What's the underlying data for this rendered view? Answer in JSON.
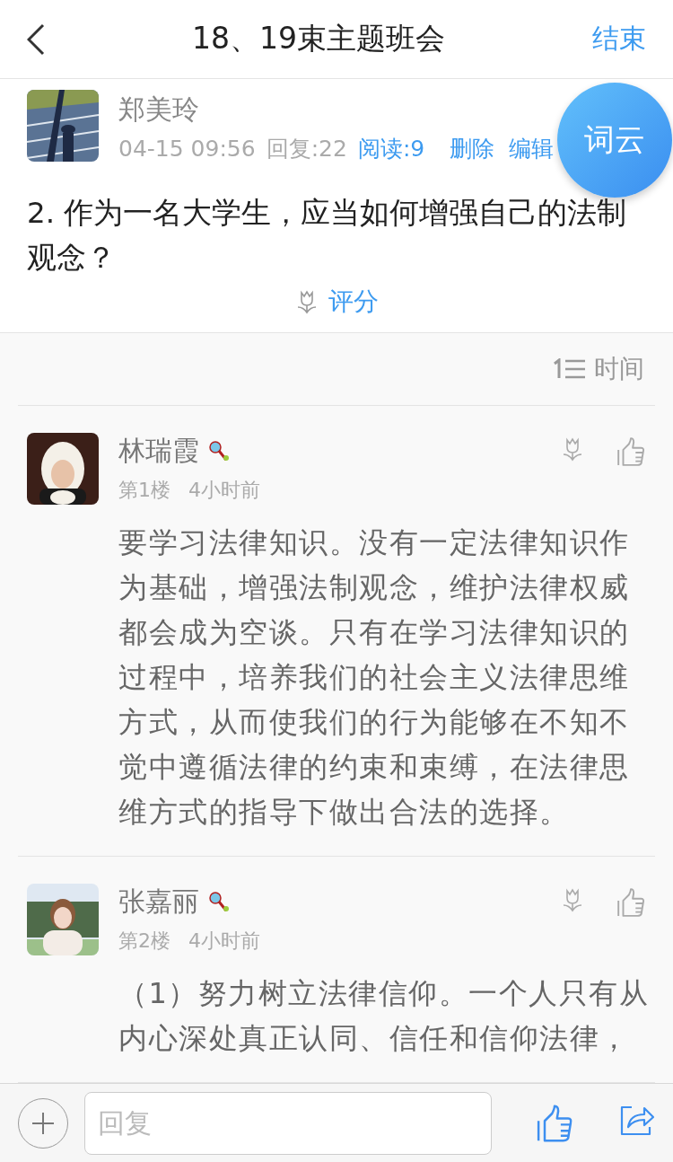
{
  "header": {
    "title": "18、19束主题班会",
    "action": "结束"
  },
  "post": {
    "author": "郑美玲",
    "date": "04-15 09:56",
    "replies": "回复:22",
    "reads": "阅读:9",
    "actions": [
      "删除",
      "编辑"
    ],
    "body": "2. 作为一名大学生，应当如何增强自己的法制观念？",
    "rate": "评分"
  },
  "floating_button": "词云",
  "sort": {
    "label": "时间"
  },
  "replies": [
    {
      "name": "林瑞霞",
      "floor": "第1楼",
      "time": "4小时前",
      "text": "要学习法律知识。没有一定法律知识作为基础，增强法制观念，维护法律权威都会成为空谈。只有在学习法律知识的过程中，培养我们的社会主义法律思维方式，从而使我们的行为能够在不知不觉中遵循法律的约束和束缚，在法律思维方式的指导下做出合法的选择。"
    },
    {
      "name": "张嘉丽",
      "floor": "第2楼",
      "time": "4小时前",
      "text": "（1）努力树立法律信仰。一个人只有从内心深处真正认同、信任和信仰法律，"
    }
  ],
  "composer": {
    "placeholder": "回复"
  }
}
